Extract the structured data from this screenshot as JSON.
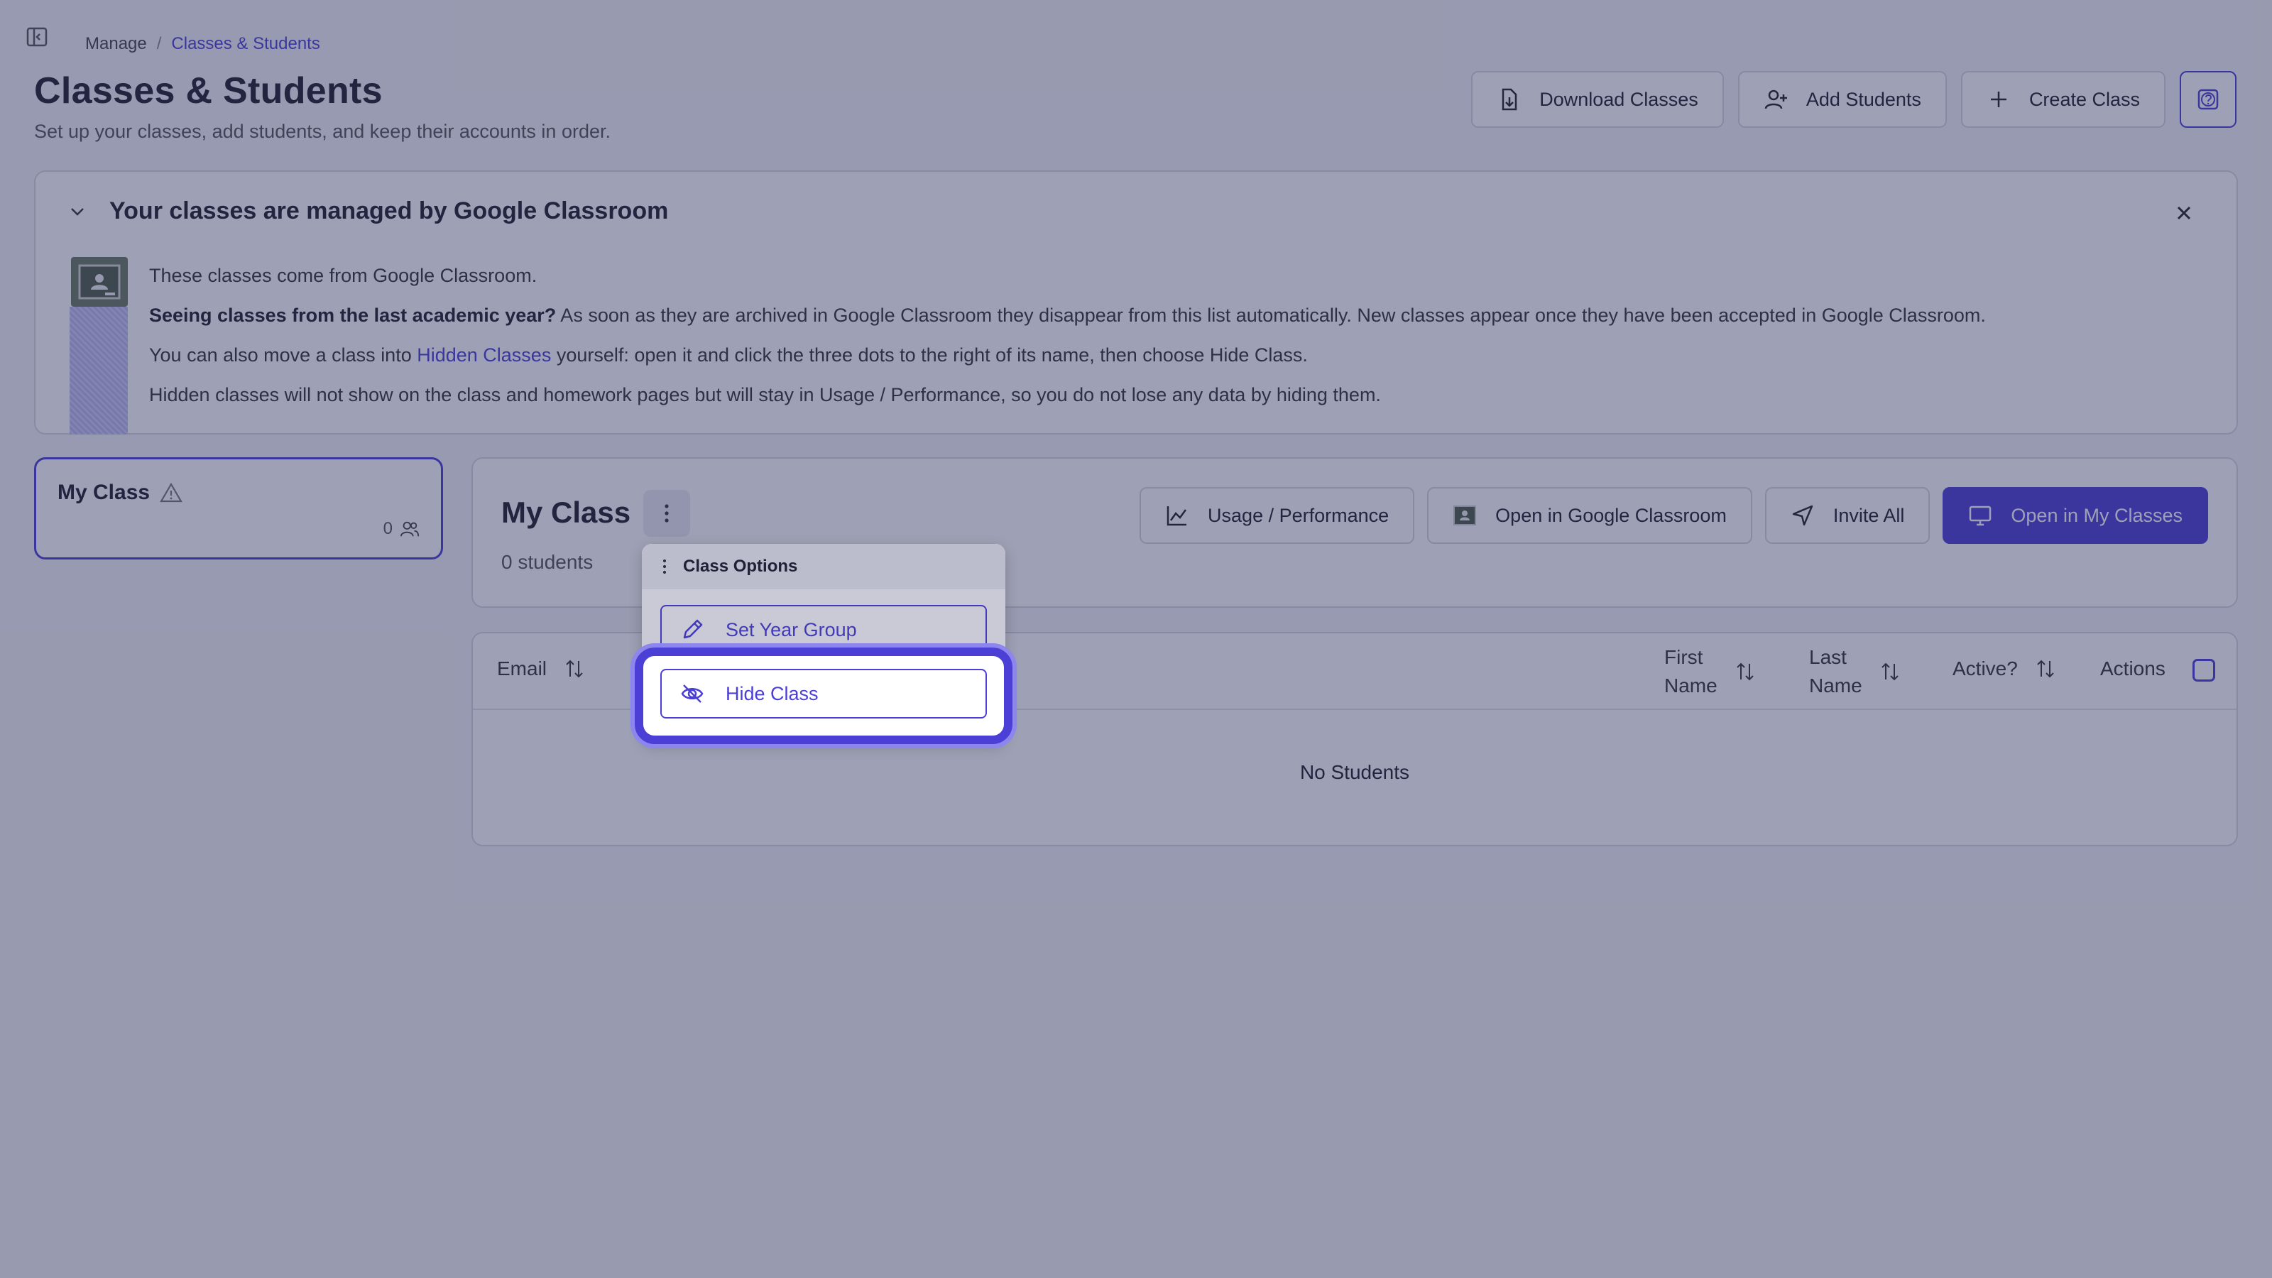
{
  "breadcrumb": {
    "parent": "Manage",
    "separator": "/",
    "current": "Classes & Students"
  },
  "page": {
    "title": "Classes & Students",
    "subtitle": "Set up your classes, add students, and keep their accounts in order."
  },
  "top_actions": {
    "download": "Download Classes",
    "add_students": "Add Students",
    "create_class": "Create Class"
  },
  "banner": {
    "title": "Your classes are managed by Google Classroom",
    "line1": "These classes come from Google Classroom.",
    "line2_bold": "Seeing classes from the last academic year?",
    "line2_rest": " As soon as they are archived in Google Classroom they disappear from this list automatically. New classes appear once they have been accepted in Google Classroom.",
    "line3_pre": "You can also move a class into ",
    "line3_link": "Hidden Classes",
    "line3_post": " yourself: open it and click the three dots to the right of its name, then choose Hide Class.",
    "line4": "Hidden classes will not show on the class and homework pages but will stay in Usage / Performance, so you do not lose any data by hiding them."
  },
  "class_card": {
    "name": "My Class",
    "count": "0"
  },
  "class_panel": {
    "title": "My Class",
    "students": "0 students",
    "usage": "Usage / Performance",
    "open_google": "Open in Google Classroom",
    "invite_all": "Invite All",
    "open_my_classes": "Open in My Classes"
  },
  "table": {
    "email": "Email",
    "first_name_1": "First",
    "first_name_2": "Name",
    "last_name_1": "Last",
    "last_name_2": "Name",
    "active": "Active?",
    "actions": "Actions",
    "empty": "No Students"
  },
  "dropdown": {
    "header": "Class Options",
    "set_year_group": "Set Year Group",
    "hide_class": "Hide Class"
  },
  "colors": {
    "accent": "#4b3fd6",
    "overlay": "#282c5a"
  }
}
